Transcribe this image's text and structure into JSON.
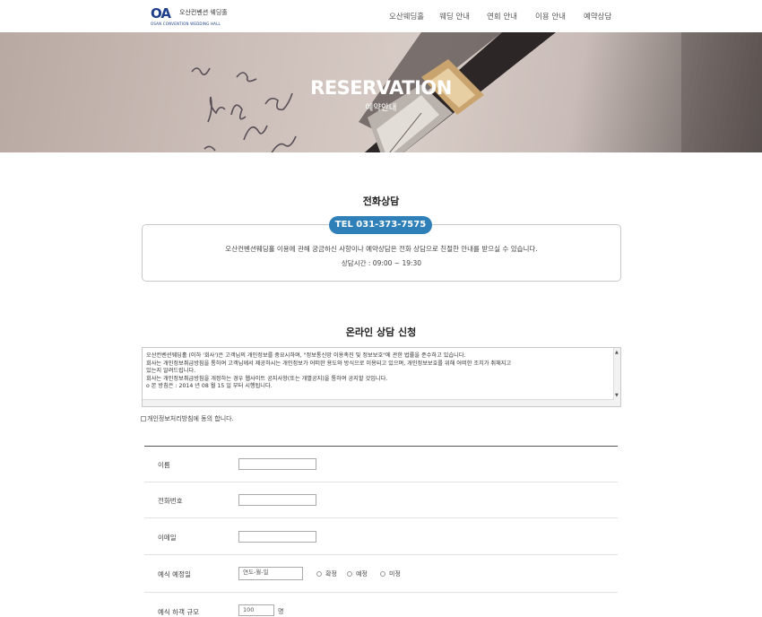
{
  "header": {
    "logo_mark": "OA",
    "logo_ko": "오산컨벤션 웨딩홀",
    "logo_en": "OSAN CONVENTION WEDDING HALL",
    "nav": [
      "오산웨딩홀",
      "웨딩 안내",
      "연회 안내",
      "이용 안내",
      "예약상담"
    ]
  },
  "hero": {
    "title": "RESERVATION",
    "subtitle": "예약안내"
  },
  "phone_section": {
    "title": "전화상담",
    "tel": "TEL 031-373-7575",
    "description": "오산컨벤션웨딩홀 이용에 관해 궁금하신 사항이나 예약상담은 전화 상담으로 친절한 안내를 받으실 수 있습니다.",
    "hours": "상담시간 : 09:00 ~ 19:30"
  },
  "online_section": {
    "title": "온라인 상담 신청",
    "policy_lines": [
      "오산컨벤션웨딩홀 (이하 '회사')은 고객님의 개인정보를 중요시하며, \"정보통신망 이용촉진 및 정보보호\"에 관한 법률을 준수하고 있습니다.",
      "회사는 개인정보취급방침을 통하여 고객님께서 제공하시는 개인정보가 어떠한 용도와 방식으로 이용되고 있으며, 개인정보보호를 위해 어떠한 조치가 취해지고",
      "있는지 알려드립니다.",
      "회사는 개인정보취급방침을 개정하는 경우 웹사이트 공지사항(또는 개별공지)을 통하여 공지할 것입니다.",
      "o 본 방침은 : 2014 년 08 월 15 일 부터 시행됩니다."
    ],
    "agree_label": "개인정보처리방침에 동의 합니다."
  },
  "form": {
    "name_label": "이름",
    "phone_label": "전화번호",
    "email_label": "이메일",
    "date_label": "예식 예정일",
    "date_placeholder": "연도-월-일",
    "date_options": [
      "확정",
      "예정",
      "미정"
    ],
    "guests_label": "예식 하객 규모",
    "guests_value": "100",
    "guests_unit": "명"
  }
}
